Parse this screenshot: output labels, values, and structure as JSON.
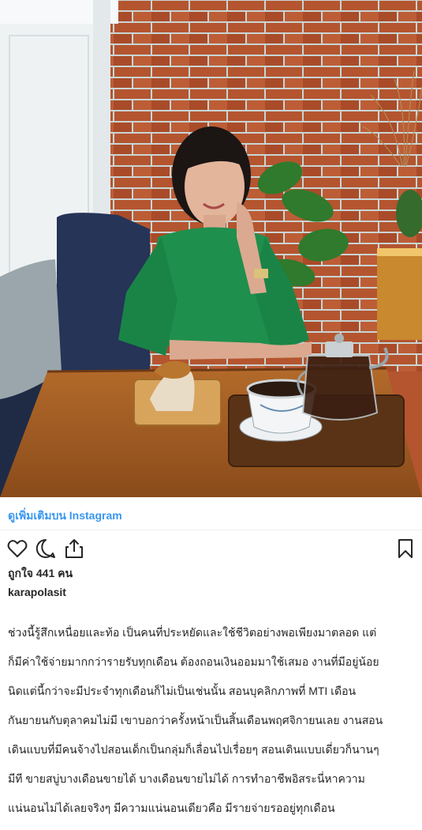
{
  "post": {
    "view_more_label": "ดูเพิ่มเติมบน Instagram",
    "likes_label": "ถูกใจ 441 คน",
    "username": "karapolasit",
    "caption_lines": [
      "ช่วงนี้รู้สึกเหนื่อยและท้อ เป็นคนที่ประหยัดและใช้ชีวิตอย่างพอเพียงมาตลอด แต่",
      "ก็มีค่าใช้จ่ายมากกว่ารายรับทุกเดือน ต้องถอนเงินออมมาใช้เสมอ งานที่มีอยู่น้อย",
      "นิดแต่นี้กว่าจะมีประจำทุกเดือนก็ไม่เป็นเช่นนั้น สอนบุคลิกภาพที่ MTI เดือน",
      "กันยายนกับตุลาคมไม่มี เขาบอกว่าครั้งหน้าเป็นสิ้นเดือนพฤศจิกายนเลย งานสอน",
      "เดินแบบที่มีคนจ้างไปสอนเด็กเป็นกลุ่มก็เลื่อนไปเรื่อยๆ สอนเดินแบบเดี่ยวก็นานๆ",
      "มีที ขายสบู่บางเดือนขายได้ บางเดือนขายไม่ได้ การทำอาชีพอิสระนี่หาความ",
      "แน่นอนไม่ได้เลยจริงๆ มีความแน่นอนเดียวคือ มีรายจ่ายรออยู่ทุกเดือน"
    ]
  },
  "photo": {
    "cup_label": "",
    "icons": [
      "heart-icon",
      "comment-icon",
      "share-icon",
      "bookmark-icon"
    ]
  },
  "colors": {
    "link": "#3897f0",
    "text": "#262626",
    "brick": "#b4552f",
    "dress": "#1f8f4e"
  }
}
